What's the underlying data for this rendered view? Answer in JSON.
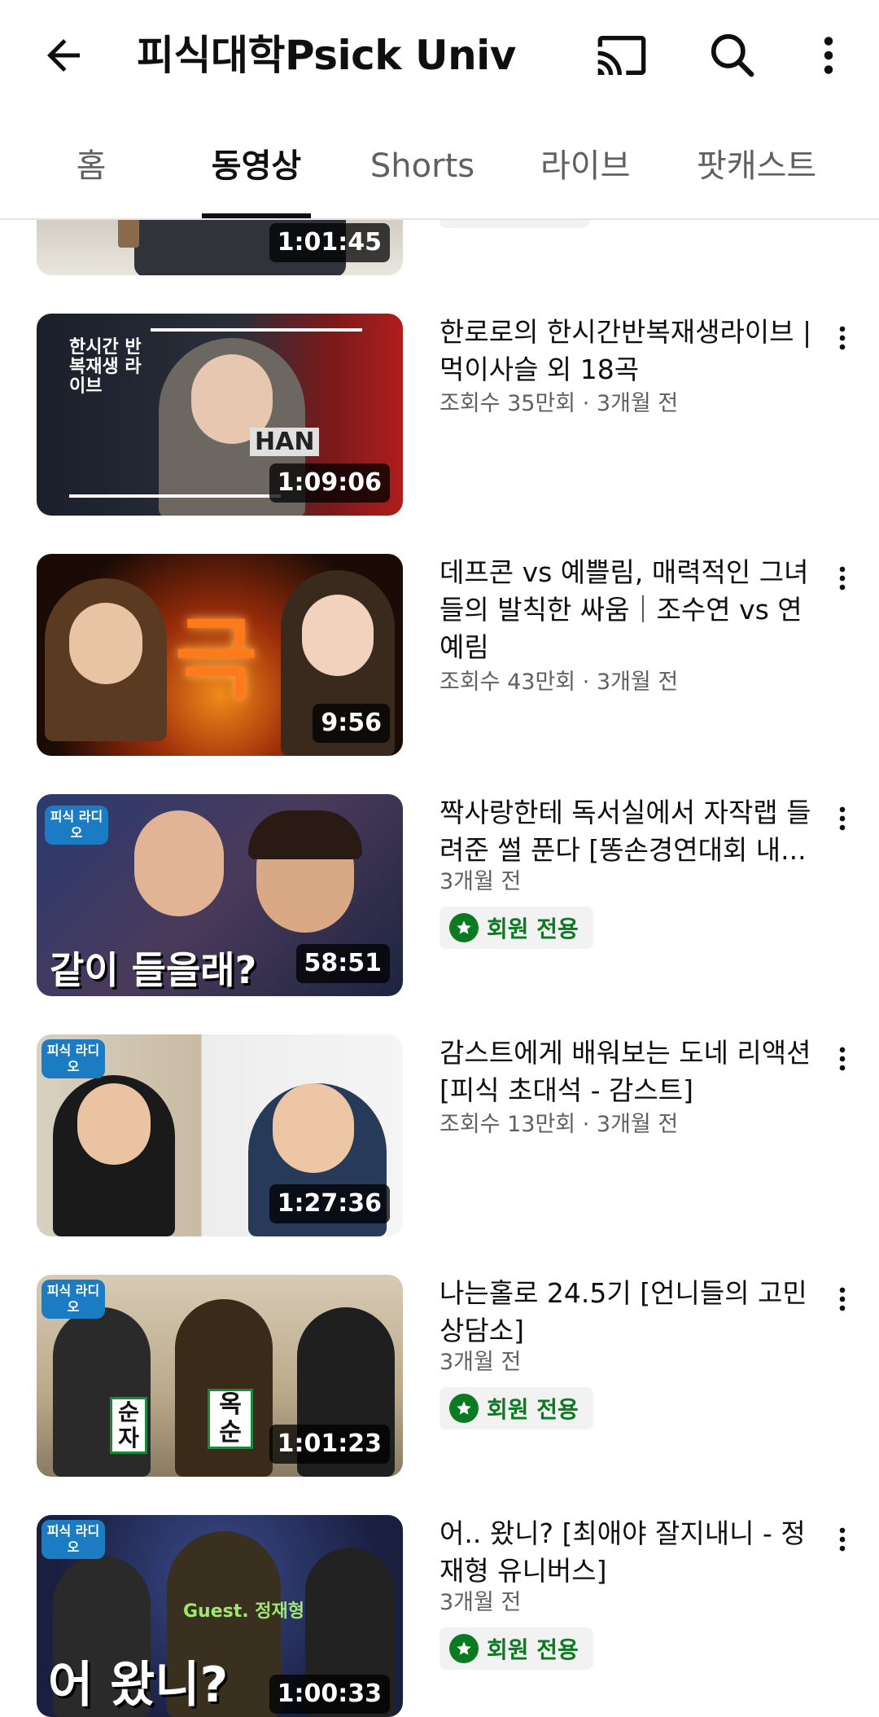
{
  "header": {
    "title": "피식대학Psick Univ"
  },
  "tabs": [
    "홈",
    "동영상",
    "Shorts",
    "라이브",
    "팟캐스트"
  ],
  "colors": {
    "member_green": "#0b7a21",
    "meta_gray": "#606060"
  },
  "icons": [
    "back-arrow-icon",
    "cast-icon",
    "search-icon",
    "more-vert-icon"
  ],
  "videos": [
    {
      "title": "",
      "meta": "",
      "duration": "1:01:45",
      "badge": ""
    },
    {
      "title": "한로로의 한시간반복재생라이브 | 먹이사슬 외 18곡",
      "meta": "조회수 35만회 · 3개월 전",
      "duration": "1:09:06",
      "thumb_text": "한시간 반복재생 라이브",
      "thumb_text2": "HAN"
    },
    {
      "title": "데프콘 vs 예쁠림, 매력적인 그녀들의 발칙한 싸움｜조수연 vs 연예림",
      "meta": "조회수 43만회 · 3개월 전",
      "duration": "9:56",
      "thumb_text": "극"
    },
    {
      "title": "짝사랑한테 독서실에서 자작랩 들려준 썰 푼다 [똥손경연대회 내...",
      "meta": "3개월 전",
      "duration": "58:51",
      "badge": "회원 전용",
      "thumb_text": "같이 들을래?",
      "thumb_text2": "피식 라디오"
    },
    {
      "title": "감스트에게 배워보는 도네 리액션 [피식 초대석 - 감스트]",
      "meta": "조회수 13만회 · 3개월 전",
      "duration": "1:27:36",
      "thumb_text2": "피식 라디오"
    },
    {
      "title": "나는홀로 24.5기 [언니들의 고민상담소]",
      "meta": "3개월 전",
      "duration": "1:01:23",
      "badge": "회원 전용",
      "thumb_text2": "피식 라디오",
      "thumb_text": "순자",
      "thumb_text3": "옥순"
    },
    {
      "title": "어.. 왔니? [최애야 잘지내니 - 정재형 유니버스]",
      "meta": "3개월 전",
      "duration": "1:00:33",
      "badge": "회원 전용",
      "thumb_text": "어 왔니?",
      "thumb_text2": "피식 라디오",
      "thumb_text3": "Guest. 정재형"
    }
  ]
}
